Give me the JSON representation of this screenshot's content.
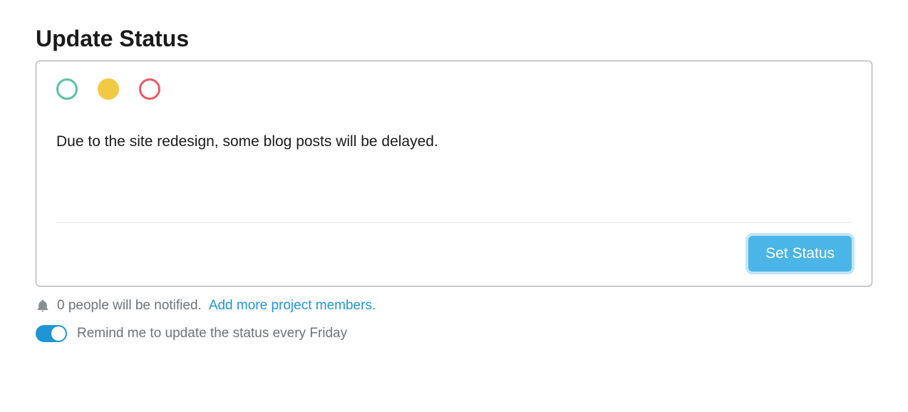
{
  "heading": "Update Status",
  "status_colors": {
    "green": "#5bc0a0",
    "yellow": "#f2c944",
    "red": "#e85c62",
    "selected": "yellow"
  },
  "status_text": "Due to the site redesign, some blog posts will be delayed.",
  "set_status_label": "Set Status",
  "footer": {
    "notify_text": "0 people will be notified.",
    "add_members_link": "Add more project members.",
    "reminder_label": "Remind me to update the status every Friday",
    "reminder_enabled": true
  }
}
